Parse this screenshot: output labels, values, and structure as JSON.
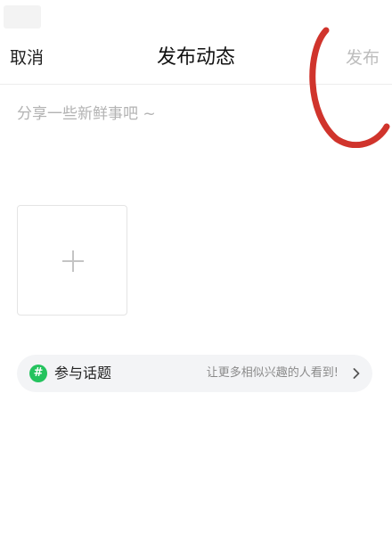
{
  "header": {
    "cancel_label": "取消",
    "title": "发布动态",
    "publish_label": "发布"
  },
  "composer": {
    "placeholder": "分享一些新鲜事吧 ~",
    "value": ""
  },
  "media": {
    "add_icon": "plus-icon"
  },
  "topic": {
    "icon": "hash-icon",
    "icon_glyph": "#",
    "label": "参与话题",
    "hint": "让更多相似兴趣的人看到!"
  },
  "colors": {
    "accent_green": "#24c35e",
    "publish_disabled": "#bdbdbd",
    "annotation_red": "#d0342c",
    "placeholder": "#b3b3b3"
  }
}
